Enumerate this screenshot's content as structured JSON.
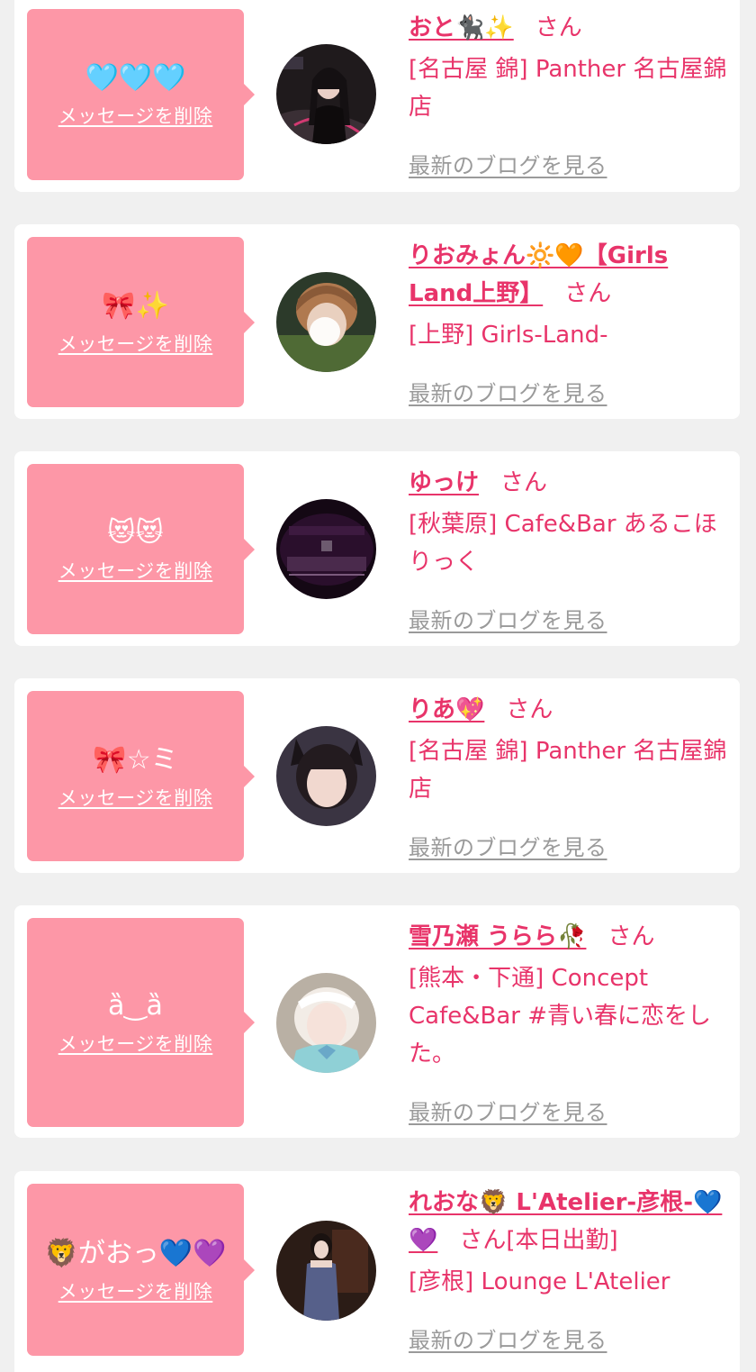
{
  "delete_label": "メッセージを削除",
  "blog_label": "最新のブログを見る",
  "san_label": "さん",
  "colors": {
    "background": "#f0f0f0",
    "card": "#ffffff",
    "bubble": "#fd97a7",
    "accent": "#e8346a",
    "muted_link": "#9a9a9a"
  },
  "entries": [
    {
      "message": "🩵🩵🩵",
      "name": "おと🐈‍⬛✨",
      "suffix": "",
      "shop": "[名古屋 錦] Panther 名古屋錦店"
    },
    {
      "message": "🎀✨",
      "name": "りおみょん🔆🧡【Girls Land上野】",
      "suffix": "",
      "shop": "[上野] Girls-Land-"
    },
    {
      "message": "😻😻",
      "name": "ゆっけ",
      "suffix": "",
      "shop": "[秋葉原] Cafe&Bar あるこほりっく"
    },
    {
      "message": "🎀☆ミ",
      "name": "りあ💖",
      "suffix": "",
      "shop": "[名古屋 錦] Panther 名古屋錦店"
    },
    {
      "message": "ȁ‿ȁ",
      "name": "雪乃瀬 うらら🥀",
      "suffix": "",
      "shop": "[熊本・下通] Concept Cafe&Bar #青い春に恋をした。"
    },
    {
      "message": "🦁がおっ💙💜",
      "name": "れおな🦁 L'Atelier-彦根-💙💜",
      "suffix": "[本日出勤]",
      "shop": "[彦根] Lounge L'Atelier"
    }
  ]
}
